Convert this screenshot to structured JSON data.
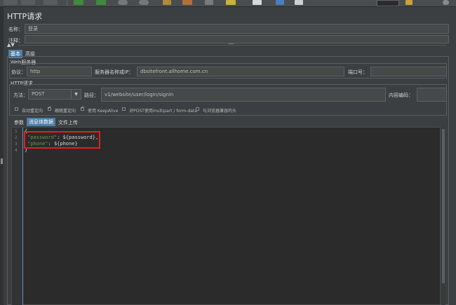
{
  "panel": {
    "title": "HTTP请求"
  },
  "name": {
    "label": "名称：",
    "value": "登录"
  },
  "comment": {
    "label": "注释：",
    "value": ""
  },
  "tabs": [
    {
      "label": "基本"
    },
    {
      "label": "高级"
    }
  ],
  "web_server": {
    "title": "Web服务器",
    "protocol_label": "协议：",
    "protocol_value": "http",
    "server_label": "服务器名称或IP：",
    "server_value": "dbsitefront.allhome.com.cn",
    "port_label": "端口号：",
    "port_value": ""
  },
  "http_request": {
    "title": "HTTP请求",
    "method_label": "方法：",
    "method_value": "POST",
    "path_label": "路径：",
    "path_value": "v1/website/user/login/signin",
    "encoding_label": "内容编码：",
    "encoding_value": ""
  },
  "options": [
    {
      "label": "自动重定向",
      "checked": false
    },
    {
      "label": "跟随重定向",
      "checked": true
    },
    {
      "label": "使用 KeepAlive",
      "checked": true
    },
    {
      "label": "对POST使用multipart / form-data",
      "checked": false
    },
    {
      "label": "与浏览器兼容的头",
      "checked": false
    }
  ],
  "body_tabs": [
    {
      "label": "参数"
    },
    {
      "label": "消息体数据"
    },
    {
      "label": "文件上传"
    }
  ],
  "body_lines": [
    {
      "num": "1",
      "text": "{"
    },
    {
      "num": "2",
      "key": "\"password\"",
      "rest": ": ${password},"
    },
    {
      "num": "3",
      "key": "\"phone\"",
      "rest": ": ${phone}"
    },
    {
      "num": "4",
      "text": "}"
    }
  ],
  "colors": {
    "accent": "#4d7fa8",
    "highlight": "#e02020",
    "background": "#3c3f41"
  }
}
